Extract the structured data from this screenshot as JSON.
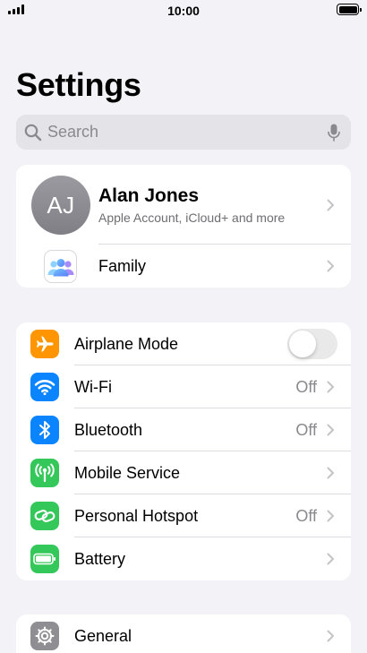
{
  "status_bar": {
    "time": "10:00",
    "signal_icon": "cellular-signal-icon",
    "battery_icon": "battery-full-icon"
  },
  "title": "Settings",
  "search": {
    "placeholder": "Search",
    "value": "",
    "icon": "search-icon",
    "mic_icon": "microphone-icon"
  },
  "profile": {
    "initials": "AJ",
    "name": "Alan Jones",
    "subtitle": "Apple Account, iCloud+ and more",
    "family_label": "Family",
    "family_icon": "family-icon"
  },
  "connectivity": {
    "items": [
      {
        "label": "Airplane Mode",
        "icon": "airplane-icon",
        "color": "#ff9500",
        "toggle": false
      },
      {
        "label": "Wi-Fi",
        "icon": "wifi-icon",
        "color": "#0a84ff",
        "value": "Off"
      },
      {
        "label": "Bluetooth",
        "icon": "bluetooth-icon",
        "color": "#0a84ff",
        "value": "Off"
      },
      {
        "label": "Mobile Service",
        "icon": "antenna-icon",
        "color": "#34c759",
        "value": ""
      },
      {
        "label": "Personal Hotspot",
        "icon": "link-icon",
        "color": "#34c759",
        "value": "Off"
      },
      {
        "label": "Battery",
        "icon": "battery-icon",
        "color": "#34c759",
        "value": ""
      }
    ]
  },
  "general_group": {
    "items": [
      {
        "label": "General",
        "icon": "gear-icon",
        "color": "#8e8e93"
      }
    ]
  }
}
